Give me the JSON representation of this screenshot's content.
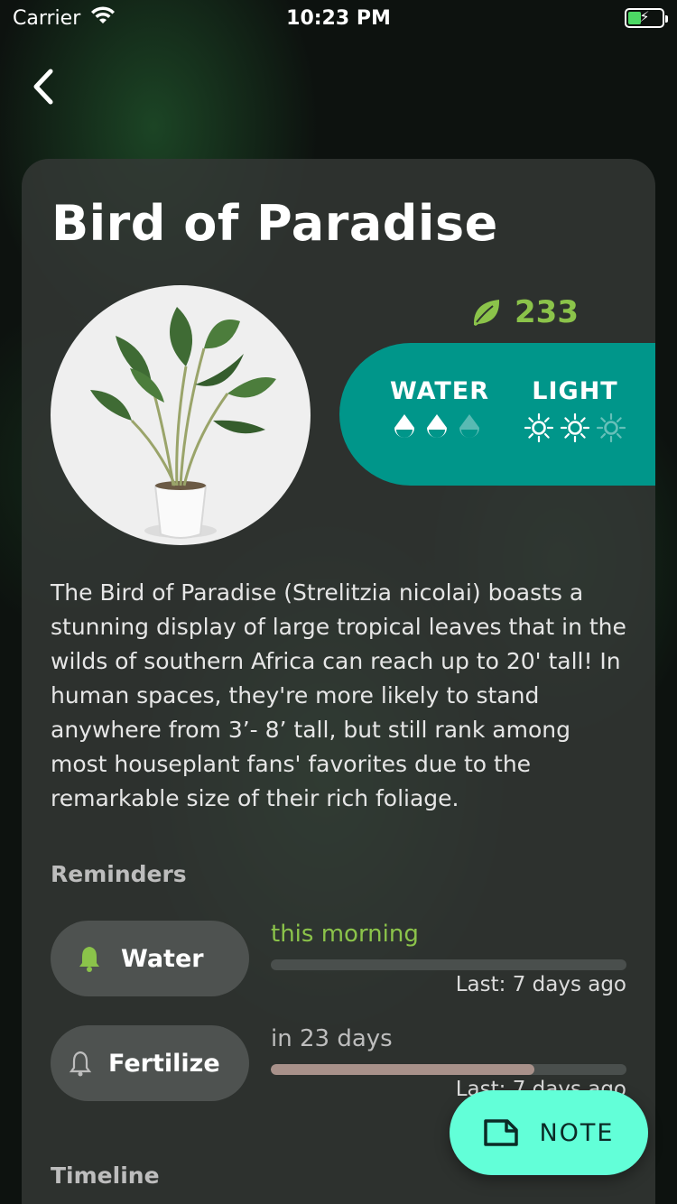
{
  "status_bar": {
    "carrier": "Carrier",
    "time": "10:23 PM"
  },
  "plant": {
    "name": "Bird of Paradise",
    "leaf_points": "233",
    "water_label": "WATER",
    "light_label": "LIGHT",
    "water_level": 2,
    "water_max": 3,
    "light_level": 2,
    "light_max": 3,
    "description": "The Bird of Paradise (Strelitzia nicolai) boasts a stunning display of large tropical leaves that in the wilds of southern Africa can reach up to 20' tall! In human spaces, they're more likely to stand anywhere from 3’- 8’ tall, but still rank among most houseplant fans' favorites due to the remarkable size of their rich foliage."
  },
  "reminders": {
    "heading": "Reminders",
    "items": [
      {
        "label": "Water",
        "when": "this morning",
        "last": "Last: 7 days ago",
        "progress": 0,
        "accent": "#8bc34a"
      },
      {
        "label": "Fertilize",
        "when": "in 23 days",
        "last": "Last: 7 days ago",
        "progress": 0.74,
        "accent": "#a8918a"
      }
    ]
  },
  "timeline": {
    "heading": "Timeline"
  },
  "note_button": {
    "label": "NOTE"
  },
  "colors": {
    "accent_green": "#8bc34a",
    "teal": "#00968a",
    "mint": "#62ffd8"
  }
}
